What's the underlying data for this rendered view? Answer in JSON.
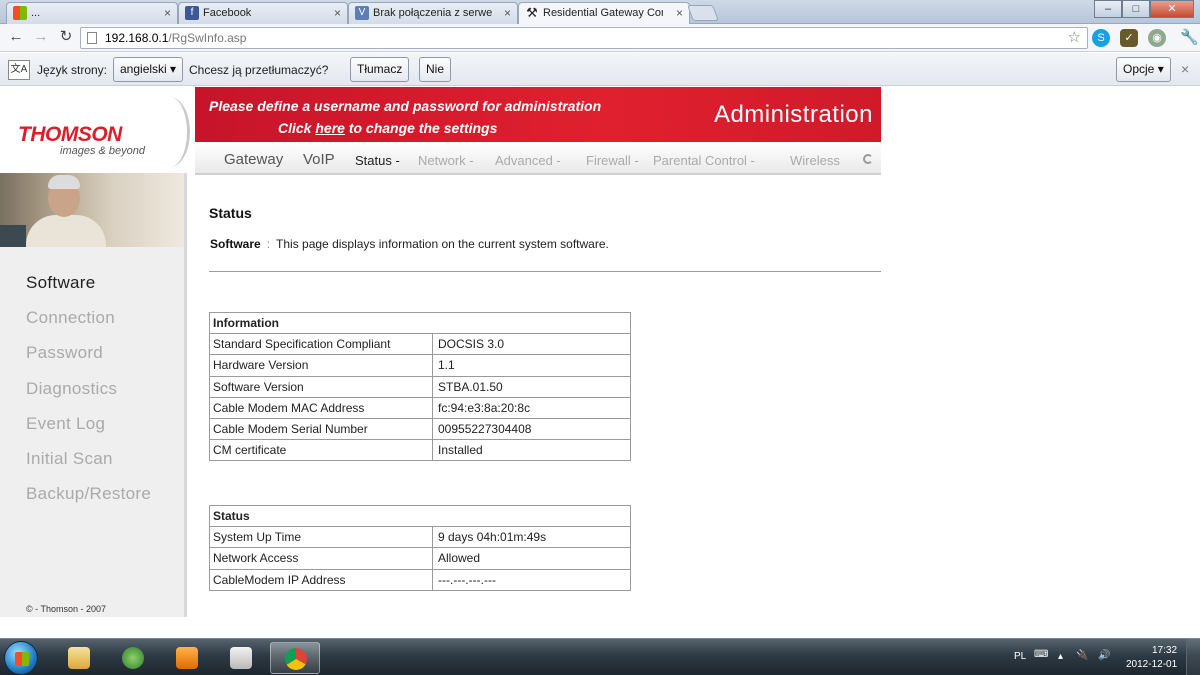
{
  "browser": {
    "tabs": [
      {
        "label": "...",
        "close": "×",
        "active": false
      },
      {
        "label": "Facebook",
        "close": "×",
        "active": false
      },
      {
        "label": "Brak połączenia z serweran",
        "close": "×",
        "active": false
      },
      {
        "label": "Residential Gateway Confi",
        "close": "×",
        "active": true
      }
    ],
    "window_buttons": {
      "minimize": "‒",
      "maximize": "□",
      "close": "✕"
    },
    "url_host": "192.168.0.1",
    "url_path": "/RgSwInfo.asp"
  },
  "translate_bar": {
    "language_label": "Język strony:",
    "language_value": "angielski",
    "question": "Chcesz ją przetłumaczyć?",
    "translate_button": "Tłumacz",
    "no_button": "Nie",
    "options_button": "Opcje",
    "close": "×"
  },
  "router": {
    "logo": "THOMSON",
    "tagline": "images & beyond",
    "banner_line1": "Please define a username and password for administration",
    "banner_line2_prefix": "Click ",
    "banner_link": "here",
    "banner_line2_suffix": " to change the settings",
    "banner_title": "Administration",
    "main_nav": [
      "Gateway",
      "VoIP"
    ],
    "sub_nav": [
      "Status -",
      "Network -",
      "Advanced -",
      "Firewall -",
      "Parental Control -",
      "Wireless"
    ],
    "side_menu": [
      "Software",
      "Connection",
      "Password",
      "Diagnostics",
      "Event Log",
      "Initial Scan",
      "Backup/Restore"
    ],
    "copyright": "© - Thomson - 2007",
    "page_title": "Status",
    "desc_label": "Software",
    "desc_sep": ":",
    "desc_text": "This page displays information on the current system software.",
    "information_table": {
      "header": "Information",
      "rows": [
        [
          "Standard Specification Compliant",
          "DOCSIS 3.0"
        ],
        [
          "Hardware Version",
          "1.1"
        ],
        [
          "Software Version",
          "STBA.01.50"
        ],
        [
          "Cable Modem MAC Address",
          "fc:94:e3:8a:20:8c"
        ],
        [
          "Cable Modem Serial Number",
          "00955227304408"
        ],
        [
          "CM certificate",
          "Installed"
        ]
      ]
    },
    "status_table": {
      "header": "Status",
      "rows": [
        [
          "System Up Time",
          "9 days 04h:01m:49s"
        ],
        [
          "Network Access",
          "Allowed"
        ],
        [
          "CableModem IP Address",
          "---.---.---.---"
        ]
      ]
    }
  },
  "taskbar": {
    "language": "PL",
    "time": "17:32",
    "date": "2012-12-01"
  },
  "colors": {
    "banner_red": "#d81f2a",
    "thomson_red": "#d81f2a"
  }
}
